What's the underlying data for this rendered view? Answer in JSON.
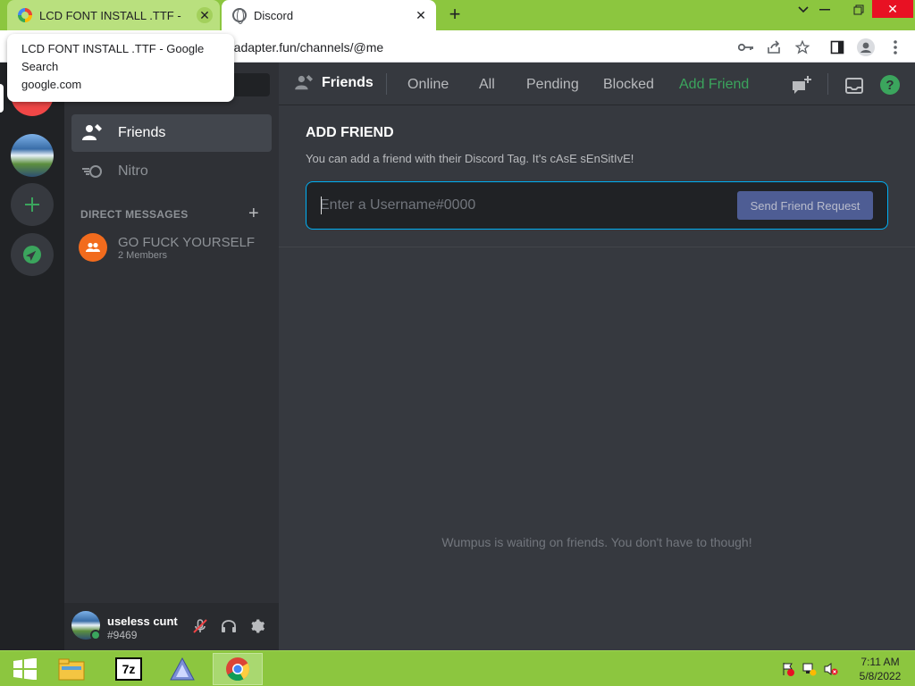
{
  "browser": {
    "tabs": [
      {
        "title": "LCD FONT INSTALL .TTF - Google",
        "close": "✕"
      },
      {
        "title": "Discord",
        "close": "✕"
      }
    ],
    "new_tab": "+",
    "window_controls": {
      "minimize": "⌄",
      "restore": "❐",
      "close": "✕"
    },
    "url_visible": "rkadapter.fun/channels/@me",
    "tooltip": {
      "title": "LCD FONT INSTALL .TTF - Google Search",
      "domain": "google.com"
    },
    "toolbar_icons": [
      "key-icon",
      "share-icon",
      "star-icon",
      "sidebar-icon",
      "profile-icon",
      "menu-icon"
    ]
  },
  "discord": {
    "sidebar": {
      "friends_label": "Friends",
      "nitro_label": "Nitro",
      "dm_header": "DIRECT MESSAGES",
      "dm_add": "+",
      "dms": [
        {
          "name": "GO FUCK YOURSELF",
          "sub": "2 Members"
        }
      ]
    },
    "user": {
      "name": "useless cunt",
      "tag": "#9469"
    },
    "header": {
      "title": "Friends",
      "tabs": [
        "Online",
        "All",
        "Pending",
        "Blocked"
      ],
      "add_friend_tab": "Add Friend",
      "help": "?"
    },
    "add_friend": {
      "title": "ADD FRIEND",
      "description": "You can add a friend with their Discord Tag. It's cAsE sEnSitIvE!",
      "placeholder": "Enter a Username#0000",
      "button": "Send Friend Request"
    },
    "empty_state": "Wumpus is waiting on friends. You don't have to though!",
    "colors": {
      "accent_green": "#3ba55d",
      "blurple_button": "#4e5d94",
      "focus_border": "#00b0f4"
    }
  },
  "taskbar": {
    "apps": [
      "windows-start-icon",
      "file-explorer-icon",
      "7zip-icon",
      "app-triangle-icon",
      "chrome-icon"
    ],
    "sevenzip_label": "7z",
    "time": "7:11 AM",
    "date": "5/8/2022"
  }
}
